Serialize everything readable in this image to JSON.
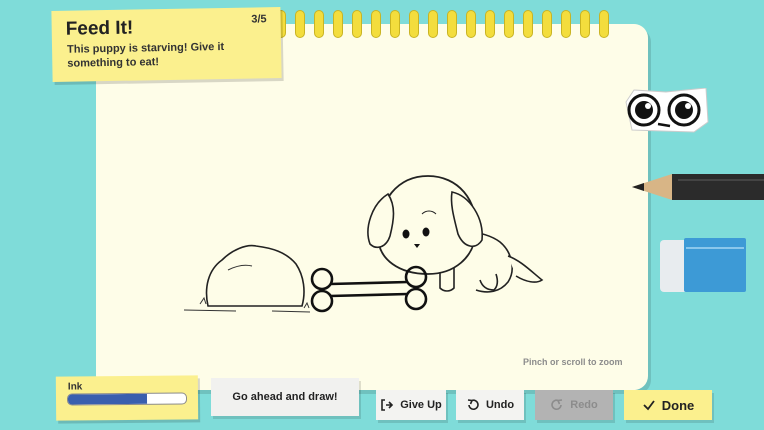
{
  "task": {
    "title": "Feed It!",
    "counter": "3/5",
    "description": "This puppy is starving! Give it something to eat!"
  },
  "canvas": {
    "hint": "Pinch or scroll to zoom"
  },
  "ink": {
    "label": "Ink",
    "level_fraction": 0.67,
    "color": "#3a5fae"
  },
  "prompt_note": "Go ahead and draw!",
  "toolbar": {
    "give_up_label": "Give Up",
    "undo_label": "Undo",
    "redo_label": "Redo",
    "done_label": "Done"
  },
  "icons": [
    "give-up-icon",
    "undo-icon",
    "redo-icon",
    "checkmark-icon",
    "googly-eyes-icon",
    "pencil-icon",
    "eraser-icon"
  ],
  "colors": {
    "background": "#7fdcd9",
    "paper": "#fefde8",
    "sticky_note": "#fbf08e",
    "ring": "#f3dd3d"
  }
}
